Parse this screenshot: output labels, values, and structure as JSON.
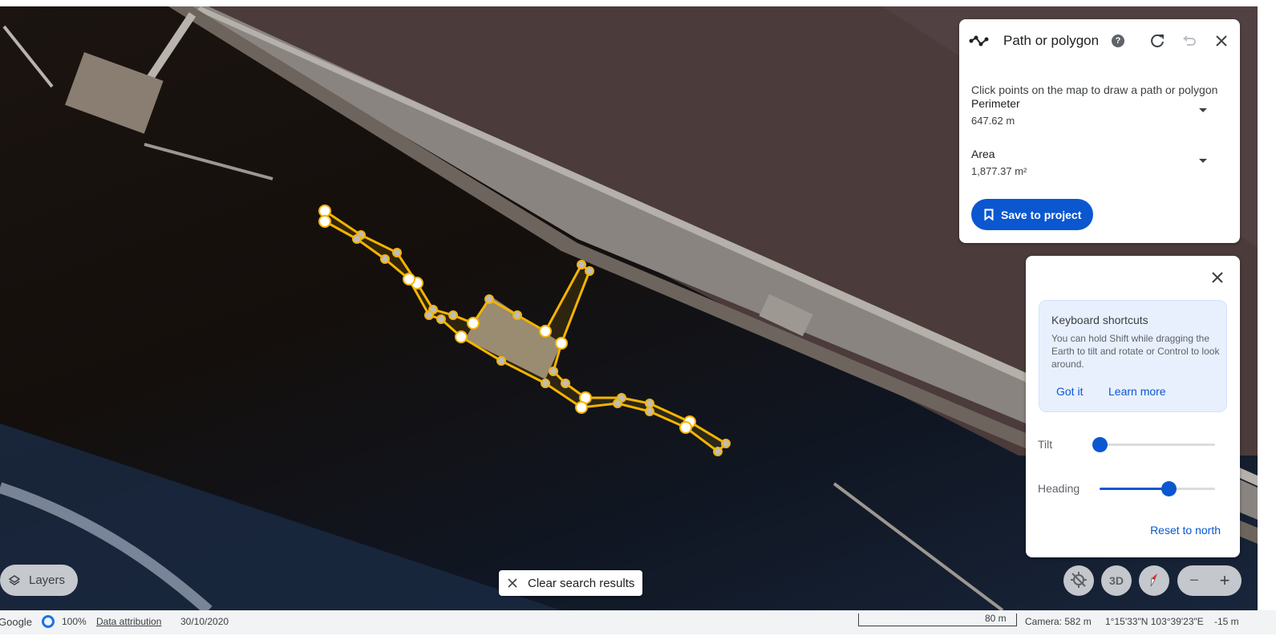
{
  "measure_panel": {
    "title": "Path or polygon",
    "hint": "Click points on the map to draw a path or polygon",
    "perimeter_label": "Perimeter",
    "perimeter_value": "647.62 m",
    "area_label": "Area",
    "area_value": "1,877.37 m²",
    "save_label": "Save to project",
    "icons": [
      "path-icon",
      "help-icon",
      "redo-icon",
      "undo-icon",
      "close-icon"
    ]
  },
  "nav_panel": {
    "shortcuts_title": "Keyboard shortcuts",
    "shortcuts_text": "You can hold Shift while dragging the Earth to tilt and rotate or Control to look around.",
    "got_it": "Got it",
    "learn_more": "Learn more",
    "tilt_label": "Tilt",
    "tilt_value": 0,
    "heading_label": "Heading",
    "heading_value": 0.6,
    "reset_north": "Reset to north"
  },
  "map_controls": {
    "layers_label": "Layers",
    "clear_search_label": "Clear search results",
    "view_3d_label": "3D",
    "zoom_out": "−",
    "zoom_in": "+"
  },
  "status_bar": {
    "brand": "Google",
    "load_percent": "100%",
    "data_attribution": "Data attribution",
    "imagery_date": "30/10/2020",
    "scale_label": "80 m",
    "camera": "Camera: 582 m",
    "coordinates": "1°15'33\"N 103°39'23\"E",
    "elevation": "-15 m"
  },
  "colors": {
    "accent": "#0b57d0",
    "polygon_stroke": "#f5b400",
    "map_land": "#4a3a38",
    "map_water": "#101622"
  }
}
